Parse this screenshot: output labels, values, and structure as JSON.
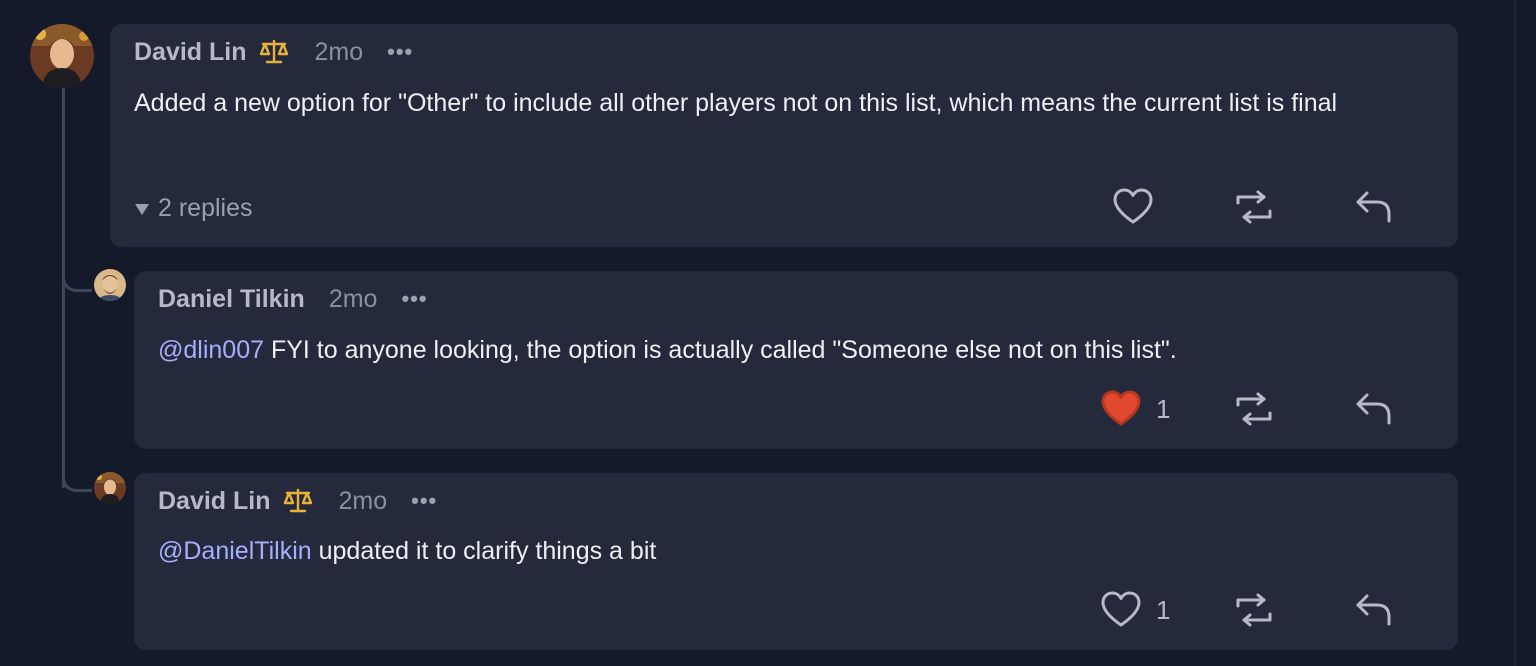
{
  "comments": [
    {
      "author": "David Lin",
      "time": "2mo",
      "more": "•••",
      "text": "Added a new option for \"Other\" to include all other players not on this list, which means the current list is final",
      "replies_label": "2 replies",
      "like_count": "",
      "liked": false
    },
    {
      "author": "Daniel Tilkin",
      "time": "2mo",
      "more": "•••",
      "mention": "@dlin007",
      "text": " FYI to anyone looking, the option is actually called \"Someone else not on this list\".",
      "like_count": "1",
      "liked": true
    },
    {
      "author": "David Lin",
      "time": "2mo",
      "more": "•••",
      "mention": "@DanielTilkin",
      "text": " updated it to clarify things a bit",
      "like_count": "1",
      "liked": false
    }
  ],
  "icons": {
    "badge": "scales-icon",
    "like": "heart-icon",
    "repost": "repost-icon",
    "reply": "reply-icon",
    "collapse": "caret-down-icon"
  },
  "colors": {
    "background": "#141a29",
    "card": "#242a3b",
    "mention": "#a8aefc",
    "liked_heart": "#e0492f",
    "badge": "#e8b23a"
  }
}
